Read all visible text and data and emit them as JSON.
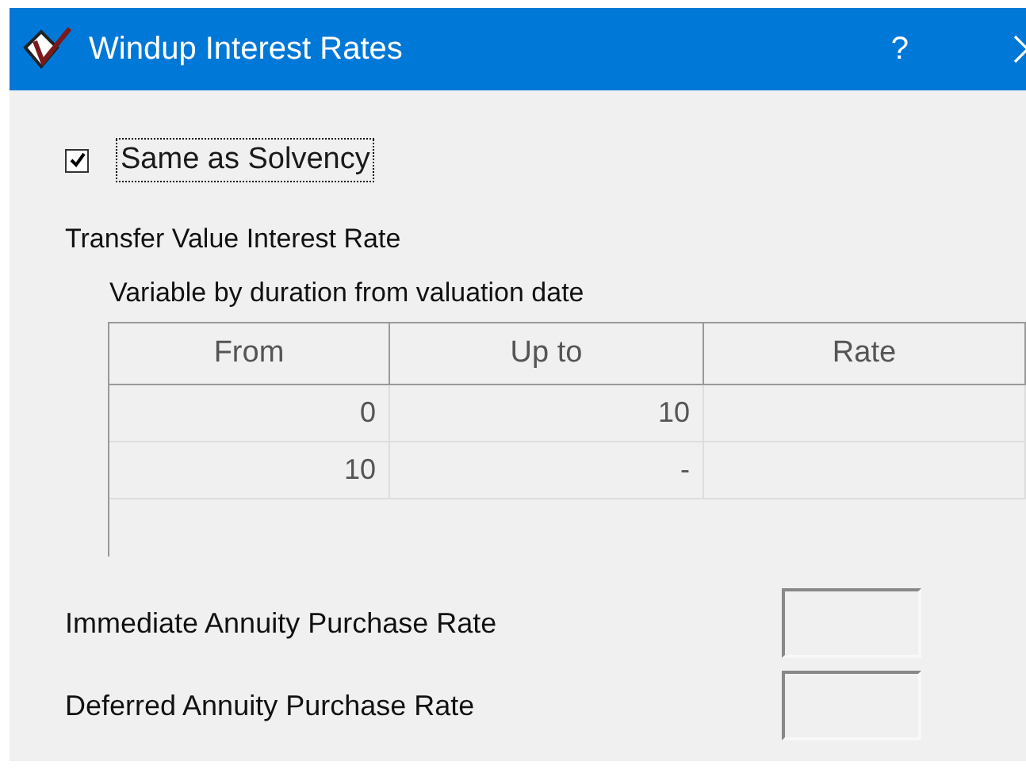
{
  "window": {
    "title": "Windup Interest Rates",
    "help": "?"
  },
  "same_as_solvency": {
    "label": "Same as Solvency",
    "checked": true
  },
  "transfer_value": {
    "heading": "Transfer Value Interest Rate",
    "subheading": "Variable by duration from valuation date",
    "table": {
      "columns": [
        "From",
        "Up to",
        "Rate"
      ],
      "rows": [
        {
          "from": "0",
          "up_to": "10"
        },
        {
          "from": "10",
          "up_to": "-"
        }
      ]
    }
  },
  "fields": [
    {
      "label": "Immediate Annuity Purchase Rate"
    },
    {
      "label": "Deferred Annuity Purchase Rate"
    }
  ]
}
